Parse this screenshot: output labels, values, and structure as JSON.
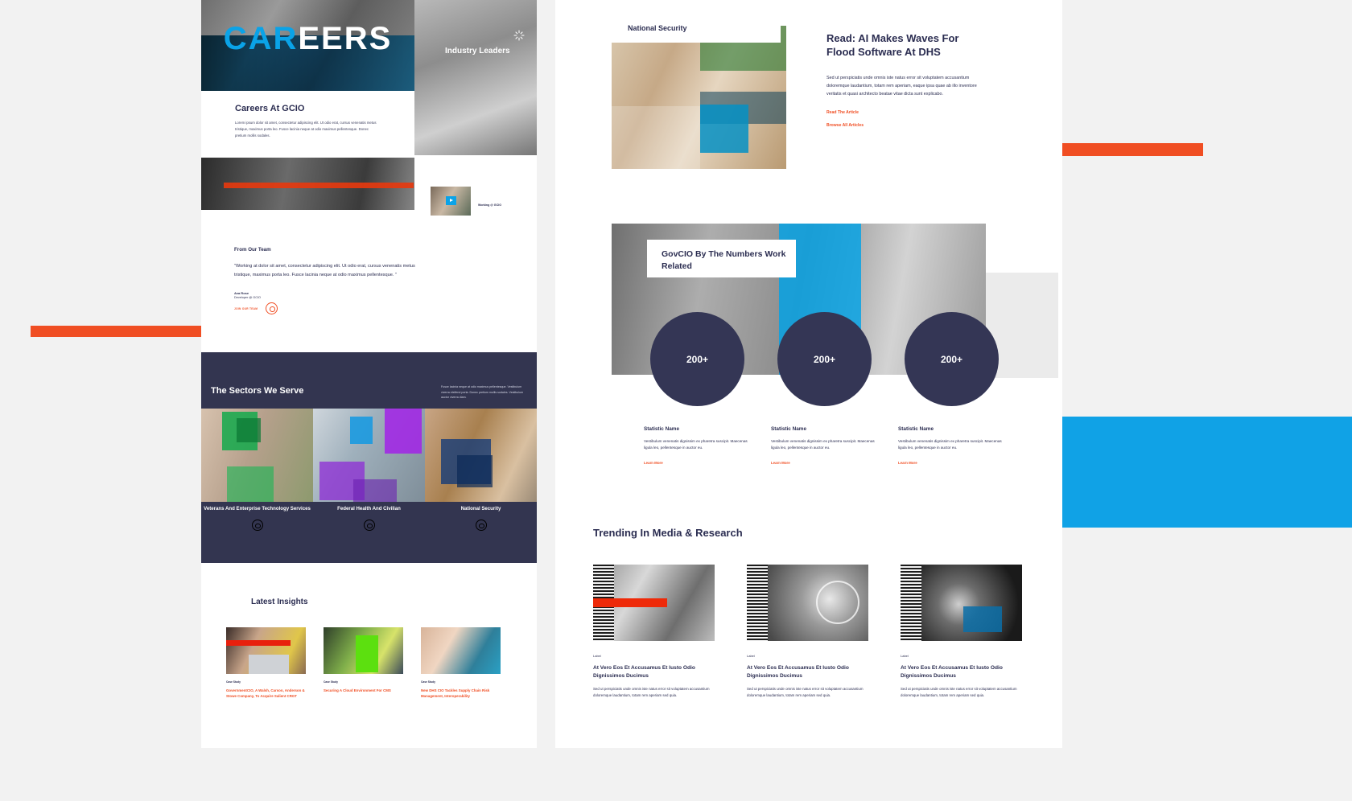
{
  "left_page": {
    "hero": {
      "title_part1": "CAR",
      "title_part2": "EERS"
    },
    "careers_card": {
      "heading": "Careers At GCIO",
      "body": "Lorem ipsum dolor sit amet, consectetur adipiscing elit. Ut odio erat, cursus venenatis metus tristique, maximus porta leo. Fusce lacinia neque at odio maximus pellentesque. Donec pretium mollis sodales."
    },
    "industry_leaders_label": "Industry Leaders",
    "video_thumb_label": "Working\n@ GCIO",
    "quote": {
      "eyebrow": "From Our Team",
      "text": "\"Working at  dolor sit amet, consectetur adipiscing elit. Ut odio erat, cursus venenatis metus tristique, maximus porta leo. Fusce lacinia neque at odio maximus pellentesque. \"",
      "name": "Ava Rose",
      "role": "Developer @ GCIO",
      "cta": "JOIN OUR TEAM"
    },
    "sectors": {
      "heading": "The Sectors We Serve",
      "lede": "Fusce lacinia neque at odio maximus pellentesque. Vestibulum viverra eleifend porta. Donec pretium mollis sodales. Vestibulum auctor viverra diam.",
      "items": [
        {
          "label": "Veterans And Enterprise Technology Services"
        },
        {
          "label": "Federal Health And Civilian"
        },
        {
          "label": "National Security"
        }
      ]
    },
    "insights": {
      "heading": "Latest Insights",
      "cards": [
        {
          "label": "Case Study",
          "title": "GovernmentCIO, A Walsh, Carson, Anderson & Stowe Company, To Acquire Salient CRGT"
        },
        {
          "label": "Case Study",
          "title": "Securing A Cloud Environment For CMS"
        },
        {
          "label": "Case Study",
          "title": "New DHS CIO Tackles Supply Chain Risk Management, Interoperability"
        }
      ]
    }
  },
  "right_page": {
    "feature": {
      "tab_label": "National Security",
      "heading": "Read: AI Makes Waves For Flood Software At DHS",
      "body": "Sed ut perspiciatis unde omnis iste natus error sit voluptatem accusantium doloremque laudantium, totam rem aperiam, eaque ipsa quae ab illo inventore veritatis et quasi architecto beatae vitae dicta sunt explicabo.",
      "link_primary": "Read The Article",
      "link_secondary": "Browse All Articles"
    },
    "numbers": {
      "card_title": "GovCIO By The Numbers Work Related",
      "stats": [
        {
          "value": "200+",
          "name": "Statistic Name",
          "desc": "Vestibulum venenatis dignissim ex pharetra suscipit. Maecenas ligula leo, pellentesque in auctor eu.",
          "link": "Learn More"
        },
        {
          "value": "200+",
          "name": "Statistic Name",
          "desc": "Vestibulum venenatis dignissim ex pharetra suscipit. Maecenas ligula leo, pellentesque in auctor eu.",
          "link": "Learn More"
        },
        {
          "value": "200+",
          "name": "Statistic Name",
          "desc": "Vestibulum venenatis dignissim ex pharetra suscipit. Maecenas ligula leo, pellentesque in auctor eu.",
          "link": "Learn More"
        }
      ]
    },
    "trending": {
      "heading": "Trending In Media & Research",
      "cards": [
        {
          "label": "Label",
          "title": "At Vero Eos Et Accusamus Et Iusto Odio Dignissimos Ducimus",
          "desc": "Sed ut perspiciatis unde omnis iste natus error sit voluptatem accusantium doloremque laudantium, totam rem aperiam sed quia."
        },
        {
          "label": "Label",
          "title": "At Vero Eos Et Accusamus Et Iusto Odio Dignissimos Ducimus",
          "desc": "Sed ut perspiciatis unde omnis iste natus error sit voluptatem accusantium doloremque laudantium, totam rem aperiam sed quia."
        },
        {
          "label": "Label",
          "title": "At Vero Eos Et Accusamus Et Iusto Odio Dignissimos Ducimus",
          "desc": "Sed ut perspiciatis unde omnis iste natus error sit voluptatem accusantium doloremque laudantium, totam rem aperiam sed quia."
        }
      ]
    }
  },
  "theme": {
    "orange": "#f04e23",
    "blue": "#10a2e6",
    "navy": "#2b2d51",
    "slate": "#343655",
    "page_bg": "#f2f2f2"
  }
}
